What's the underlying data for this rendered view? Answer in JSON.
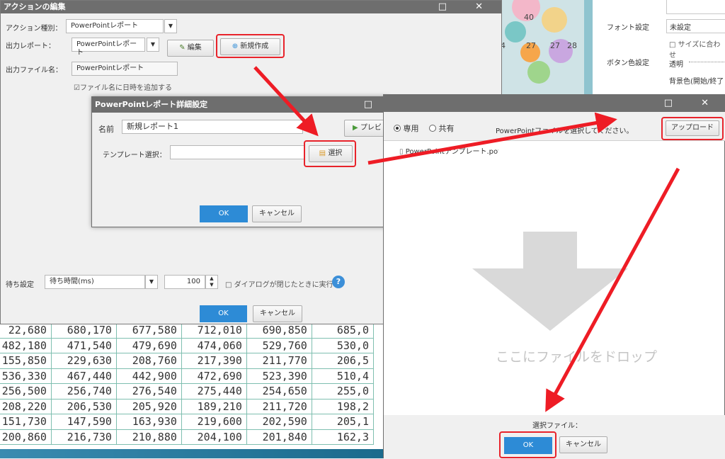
{
  "background_app": {
    "badge_numbers": [
      "40",
      "4",
      "27",
      "27",
      "28"
    ],
    "props": {
      "font_setting_label": "フォント設定",
      "font_setting_value": "未設定",
      "fit_size_label": "□ サイズに合わせ",
      "button_color_label": "ボタン色設定",
      "transparency_label": "透明",
      "bg_color_label": "背景色(開始/終了"
    }
  },
  "spreadsheet": {
    "rows": [
      [
        "22,680",
        "680,170",
        "677,580",
        "712,010",
        "690,850",
        "685,0"
      ],
      [
        "482,180",
        "471,540",
        "479,690",
        "474,060",
        "529,760",
        "530,0"
      ],
      [
        "155,850",
        "229,630",
        "208,760",
        "217,390",
        "211,770",
        "206,5"
      ],
      [
        "536,330",
        "467,440",
        "442,900",
        "472,690",
        "523,390",
        "510,4"
      ],
      [
        "256,500",
        "256,740",
        "276,540",
        "275,440",
        "254,650",
        "255,0"
      ],
      [
        "208,220",
        "206,530",
        "205,920",
        "189,210",
        "211,720",
        "198,2"
      ],
      [
        "151,730",
        "147,590",
        "163,930",
        "219,600",
        "202,590",
        "205,1"
      ],
      [
        "200,860",
        "216,730",
        "210,880",
        "204,100",
        "201,840",
        "162,3"
      ]
    ]
  },
  "action_dialog": {
    "title": "アクションの編集",
    "titlebar_buttons": "□ ✕",
    "action_type_label": "アクション種別：",
    "action_type_value": "PowerPointレポート",
    "output_report_label": "出力レポート：",
    "output_report_value": "PowerPointレポート",
    "edit_button": "編集",
    "new_button": "新規作成",
    "output_filename_label": "出力ファイル名：",
    "output_filename_value": "PowerPointレポート",
    "add_datetime_checkbox": "☑ファイル名に日時を追加する",
    "wait_label": "待ち設定",
    "wait_type_value": "待ち時間(ms)",
    "wait_amount": "100",
    "run_on_close_checkbox": "□ ダイアログが閉じたときに実行",
    "ok_button": "OK",
    "cancel_button": "キャンセル"
  },
  "pp_dialog": {
    "title": "PowerPointレポート詳細設定",
    "titlebar_buttons": "□",
    "name_label": "名前",
    "name_value": "新規レポート1",
    "preview_button": "プレビ",
    "template_label": "テンプレート選択：",
    "template_value": "",
    "select_button": "選択",
    "ok_button": "OK",
    "cancel_button": "キャンセル"
  },
  "upload_dialog": {
    "titlebar_buttons": "□ ✕",
    "radio_private": "専用",
    "radio_shared": "共有",
    "instruction": "PowerPointファイルを選択してください。",
    "upload_button": "アップロード",
    "file_item": "PowerPointテンプレート.pot",
    "drop_text": "ここにファイルをドロップ",
    "selected_file_label": "選択ファイル：",
    "ok_button": "OK",
    "cancel_button": "キャンセル"
  },
  "colors": {
    "titlebar": "#6e6e6e",
    "primary_button": "#2d8bd6",
    "highlight": "#e8232b",
    "grid_line": "#7fbfb0"
  }
}
